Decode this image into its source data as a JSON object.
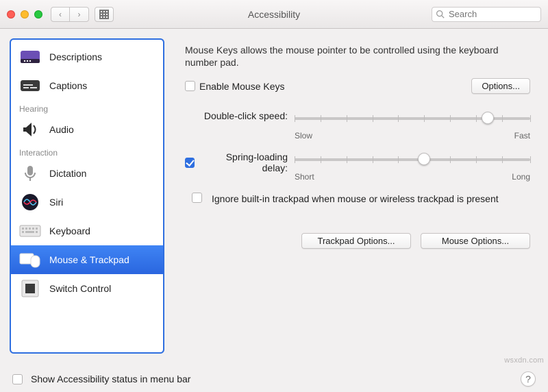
{
  "window": {
    "title": "Accessibility"
  },
  "search": {
    "placeholder": "Search"
  },
  "sidebar": {
    "sections": {
      "hearing": "Hearing",
      "interaction": "Interaction"
    },
    "items": [
      {
        "label": "Descriptions"
      },
      {
        "label": "Captions"
      },
      {
        "label": "Audio"
      },
      {
        "label": "Dictation"
      },
      {
        "label": "Siri"
      },
      {
        "label": "Keyboard"
      },
      {
        "label": "Mouse & Trackpad"
      },
      {
        "label": "Switch Control"
      }
    ]
  },
  "panel": {
    "description": "Mouse Keys allows the mouse pointer to be controlled using the keyboard number pad.",
    "enable_mouse_keys": {
      "label": "Enable Mouse Keys",
      "checked": false
    },
    "options_btn": "Options...",
    "double_click": {
      "label": "Double-click speed:",
      "low": "Slow",
      "high": "Fast",
      "value": 0.82
    },
    "spring_loading": {
      "checked": true,
      "label": "Spring-loading delay:",
      "low": "Short",
      "high": "Long",
      "value": 0.55
    },
    "ignore_trackpad": {
      "checked": false,
      "label": "Ignore built-in trackpad when mouse or wireless trackpad is present"
    },
    "trackpad_options_btn": "Trackpad Options...",
    "mouse_options_btn": "Mouse Options..."
  },
  "footer": {
    "show_status_label": "Show Accessibility status in menu bar",
    "show_status_checked": false
  },
  "watermark": "wsxdn.com"
}
